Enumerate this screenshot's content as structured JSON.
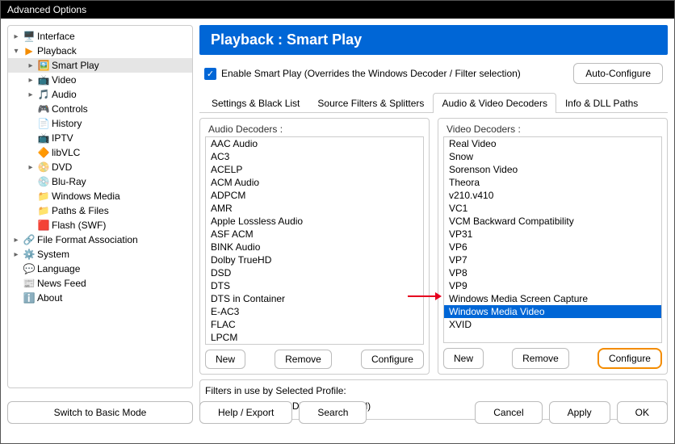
{
  "window": {
    "title": "Advanced Options"
  },
  "sidebar": {
    "items": [
      {
        "label": "Interface",
        "chev": "▸",
        "icon": "🖥️"
      },
      {
        "label": "Playback",
        "chev": "▾",
        "icon": "▶",
        "iconColor": "#f48c00"
      },
      {
        "label": "Smart Play",
        "chev": "▸",
        "icon": "🖼️",
        "indent": 1,
        "selected": true
      },
      {
        "label": "Video",
        "chev": "▸",
        "icon": "📺",
        "indent": 1
      },
      {
        "label": "Audio",
        "chev": "▸",
        "icon": "🎵",
        "iconColor": "#f48c00",
        "indent": 1
      },
      {
        "label": "Controls",
        "chev": "",
        "icon": "🎮",
        "indent": 1
      },
      {
        "label": "History",
        "chev": "",
        "icon": "📄",
        "indent": 1
      },
      {
        "label": "IPTV",
        "chev": "",
        "icon": "📺",
        "iconColor": "#c0392b",
        "indent": 1
      },
      {
        "label": "libVLC",
        "chev": "",
        "icon": "🔶",
        "indent": 1
      },
      {
        "label": "DVD",
        "chev": "▸",
        "icon": "📀",
        "iconColor": "#f1c40f",
        "indent": 1
      },
      {
        "label": "Blu-Ray",
        "chev": "",
        "icon": "💿",
        "indent": 1
      },
      {
        "label": "Windows Media",
        "chev": "",
        "icon": "📁",
        "iconColor": "#e6a23c",
        "indent": 1
      },
      {
        "label": "Paths & Files",
        "chev": "",
        "icon": "📁",
        "iconColor": "#e6a23c",
        "indent": 1
      },
      {
        "label": "Flash (SWF)",
        "chev": "",
        "icon": "🟥",
        "indent": 1
      },
      {
        "label": "File Format Association",
        "chev": "▸",
        "icon": "🔗",
        "iconColor": "#f48c00"
      },
      {
        "label": "System",
        "chev": "▸",
        "icon": "⚙️",
        "iconColor": "#f48c00"
      },
      {
        "label": "Language",
        "chev": "",
        "icon": "💬"
      },
      {
        "label": "News Feed",
        "chev": "",
        "icon": "📰"
      },
      {
        "label": "About",
        "chev": "",
        "icon": "ℹ️",
        "iconColor": "#0066d6"
      }
    ]
  },
  "header": {
    "title": "Playback : Smart Play"
  },
  "enable": {
    "label": "Enable Smart Play (Overrides the Windows Decoder / Filter selection)"
  },
  "autoConfigure": "Auto-Configure",
  "tabs": [
    {
      "label": "Settings & Black List"
    },
    {
      "label": "Source Filters & Splitters"
    },
    {
      "label": "Audio & Video Decoders",
      "active": true
    },
    {
      "label": "Info & DLL Paths"
    }
  ],
  "audio": {
    "title": "Audio Decoders :",
    "items": [
      "AAC Audio",
      "AC3",
      "ACELP",
      "ACM Audio",
      "ADPCM",
      "AMR",
      "Apple Lossless Audio",
      "ASF ACM",
      "BINK Audio",
      "Dolby TrueHD",
      "DSD",
      "DTS",
      "DTS in Container",
      "E-AC3",
      "FLAC",
      "LPCM"
    ],
    "new": "New",
    "remove": "Remove",
    "configure": "Configure"
  },
  "video": {
    "title": "Video Decoders :",
    "items": [
      "Real Video",
      "Snow",
      "Sorenson Video",
      "Theora",
      "v210.v410",
      "VC1",
      "VCM Backward Compatibility",
      "VP31",
      "VP6",
      "VP7",
      "VP8",
      "VP9",
      "Windows Media Screen Capture",
      "Windows Media Video",
      "XVID"
    ],
    "selectedIndex": 13,
    "new": "New",
    "remove": "Remove",
    "configure": "Configure"
  },
  "filters": {
    "title": "Filters in use by Selected Profile:",
    "value": "WMVideo Decoder DMO (Registered)"
  },
  "footer": {
    "basic": "Switch to Basic Mode",
    "help": "Help / Export",
    "search": "Search",
    "cancel": "Cancel",
    "apply": "Apply",
    "ok": "OK"
  }
}
